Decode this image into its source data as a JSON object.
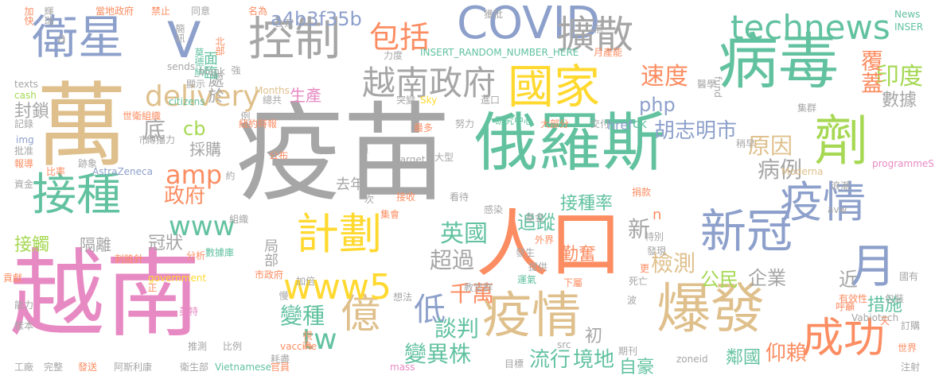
{
  "palette": {
    "gray": "#a6a6a6",
    "tan": "#dfc08c",
    "teal": "#62c2a0",
    "blue": "#8da0cb",
    "pink": "#e78ac3",
    "lime": "#a6d854",
    "yellow": "#ffd92f",
    "orange": "#fc8d62"
  },
  "words": [
    {
      "t": "疫苗",
      "c": "gray"
    },
    {
      "t": "越南",
      "c": "pink"
    },
    {
      "t": "俄羅斯",
      "c": "teal"
    },
    {
      "t": "萬",
      "c": "tan"
    },
    {
      "t": "疫情",
      "c": "tan"
    },
    {
      "t": "爆發",
      "c": "tan"
    },
    {
      "t": "病毒",
      "c": "teal"
    },
    {
      "t": "人口",
      "c": "orange"
    },
    {
      "t": "劑",
      "c": "lime"
    },
    {
      "t": "新冠",
      "c": "blue"
    },
    {
      "t": "衛星",
      "c": "blue"
    },
    {
      "t": "V",
      "c": "blue"
    },
    {
      "t": "控制",
      "c": "gray"
    },
    {
      "t": "COVID",
      "c": "blue"
    },
    {
      "t": "擴散",
      "c": "gray"
    },
    {
      "t": "國家",
      "c": "yellow"
    },
    {
      "t": "計劃",
      "c": "yellow"
    },
    {
      "t": "接種",
      "c": "teal"
    },
    {
      "t": "億",
      "c": "tan"
    },
    {
      "t": "成功",
      "c": "orange"
    },
    {
      "t": "疫情",
      "c": "blue"
    },
    {
      "t": "月",
      "c": "blue"
    },
    {
      "t": "www5",
      "c": "yellow"
    },
    {
      "t": "technews",
      "c": "teal"
    },
    {
      "t": "越南政府",
      "c": "gray"
    },
    {
      "t": "delivery",
      "c": "tan"
    },
    {
      "t": "www",
      "c": "teal"
    },
    {
      "t": "包括",
      "c": "orange"
    },
    {
      "t": "a4b3f35b",
      "c": "blue"
    },
    {
      "t": "速度",
      "c": "orange"
    },
    {
      "t": "印度",
      "c": "lime"
    },
    {
      "t": "覆蓋",
      "c": "orange"
    },
    {
      "t": "數據",
      "c": "gray"
    },
    {
      "t": "php",
      "c": "blue"
    },
    {
      "t": "胡志明市",
      "c": "blue"
    },
    {
      "t": "處於",
      "c": "gray"
    },
    {
      "t": "生產",
      "c": "pink"
    },
    {
      "t": "amp",
      "c": "orange"
    },
    {
      "t": "cb",
      "c": "lime"
    },
    {
      "t": "底",
      "c": "gray"
    },
    {
      "t": "採購",
      "c": "gray"
    },
    {
      "t": "政府",
      "c": "orange"
    },
    {
      "t": "英國",
      "c": "teal"
    },
    {
      "t": "追蹤",
      "c": "teal"
    },
    {
      "t": "超過",
      "c": "gray"
    },
    {
      "t": "局部",
      "c": "gray"
    },
    {
      "t": "接種率",
      "c": "teal"
    },
    {
      "t": "勤奮",
      "c": "orange"
    },
    {
      "t": "檢測",
      "c": "tan"
    },
    {
      "t": "公民",
      "c": "lime"
    },
    {
      "t": "企業",
      "c": "gray"
    },
    {
      "t": "近",
      "c": "gray"
    },
    {
      "t": "原因",
      "c": "tan"
    },
    {
      "t": "病例",
      "c": "gray"
    },
    {
      "t": "去年",
      "c": "gray"
    },
    {
      "t": "新",
      "c": "gray"
    },
    {
      "t": "千萬",
      "c": "orange"
    },
    {
      "t": "低",
      "c": "blue"
    },
    {
      "t": "談判",
      "c": "teal"
    },
    {
      "t": "變種",
      "c": "teal"
    },
    {
      "t": "變異株",
      "c": "teal"
    },
    {
      "t": "tw",
      "c": "teal"
    },
    {
      "t": "冠狀",
      "c": "gray"
    },
    {
      "t": "隔離",
      "c": "gray"
    },
    {
      "t": "接觸",
      "c": "lime"
    },
    {
      "t": "境地",
      "c": "teal"
    },
    {
      "t": "流行",
      "c": "teal"
    },
    {
      "t": "初",
      "c": "gray"
    },
    {
      "t": "自豪",
      "c": "teal"
    },
    {
      "t": "鄰國",
      "c": "teal"
    },
    {
      "t": "仰賴",
      "c": "orange"
    },
    {
      "t": "措施",
      "c": "teal"
    },
    {
      "t": "面臨",
      "c": "teal"
    },
    {
      "t": "封鎖",
      "c": "gray"
    },
    {
      "t": "href",
      "c": "blue"
    },
    {
      "t": "ck",
      "c": "teal"
    },
    {
      "t": "n",
      "c": "orange"
    },
    {
      "t": "a",
      "c": "gray"
    },
    {
      "t": "北部",
      "c": "orange"
    },
    {
      "t": "獲批",
      "c": "gray"
    },
    {
      "t": "前",
      "c": "gray"
    },
    {
      "t": "News",
      "c": "teal"
    },
    {
      "t": "INSER",
      "c": "teal"
    },
    {
      "t": "加快",
      "c": "orange"
    },
    {
      "t": "輝瑞",
      "c": "gray"
    },
    {
      "t": "當地政府",
      "c": "orange"
    },
    {
      "t": "禁止",
      "c": "orange"
    },
    {
      "t": "同意",
      "c": "gray"
    },
    {
      "t": "名為",
      "c": "orange"
    },
    {
      "t": "公眾",
      "c": "gray"
    },
    {
      "t": "簡訊",
      "c": "gray"
    },
    {
      "t": "莫德納",
      "c": "teal"
    },
    {
      "t": "sends",
      "c": "gray"
    },
    {
      "t": "INSERT_RANDOM_NUMBER_HERE",
      "c": "teal"
    },
    {
      "t": "力度",
      "c": "gray"
    },
    {
      "t": "月產能",
      "c": "orange"
    },
    {
      "t": "_blank",
      "c": "gray"
    },
    {
      "t": "強",
      "c": "gray"
    },
    {
      "t": "texts",
      "c": "gray"
    },
    {
      "t": "顯示",
      "c": "gray"
    },
    {
      "t": "citizens",
      "c": "teal"
    },
    {
      "t": "cash",
      "c": "lime"
    },
    {
      "t": "Months",
      "c": "tan"
    },
    {
      "t": "總共",
      "c": "gray"
    },
    {
      "t": "Sky",
      "c": "yellow"
    },
    {
      "t": "突變",
      "c": "gray"
    },
    {
      "t": "進口",
      "c": "gray"
    },
    {
      "t": "fund",
      "c": "gray"
    },
    {
      "t": "醫學",
      "c": "gray"
    },
    {
      "t": "集群",
      "c": "gray"
    },
    {
      "t": "記錄",
      "c": "gray"
    },
    {
      "t": "世衛組織",
      "c": "orange"
    },
    {
      "t": "例",
      "c": "gray"
    },
    {
      "t": "紐約時報",
      "c": "orange"
    },
    {
      "t": "最多",
      "c": "orange"
    },
    {
      "t": "努力",
      "c": "gray"
    },
    {
      "t": "研究中心",
      "c": "teal"
    },
    {
      "t": "大部分",
      "c": "orange"
    },
    {
      "t": "交付",
      "c": "gray"
    },
    {
      "t": "img",
      "c": "blue"
    },
    {
      "t": "傳播力",
      "c": "gray"
    },
    {
      "t": "市",
      "c": "gray"
    },
    {
      "t": "批准",
      "c": "gray"
    },
    {
      "t": "報導",
      "c": "orange"
    },
    {
      "t": "比率",
      "c": "orange"
    },
    {
      "t": "跡象",
      "c": "gray"
    },
    {
      "t": "AstraZeneca",
      "c": "blue"
    },
    {
      "t": "公布",
      "c": "orange"
    },
    {
      "t": "適",
      "c": "gray"
    },
    {
      "t": "target",
      "c": "gray"
    },
    {
      "t": "大型",
      "c": "gray"
    },
    {
      "t": "稍早",
      "c": "gray"
    },
    {
      "t": "Moderna",
      "c": "tan"
    },
    {
      "t": "programmeSpared",
      "c": "pink"
    },
    {
      "t": "資金",
      "c": "gray"
    },
    {
      "t": "約",
      "c": "gray"
    },
    {
      "t": "次",
      "c": "gray"
    },
    {
      "t": "接收",
      "c": "orange"
    },
    {
      "t": "看待",
      "c": "gray"
    },
    {
      "t": "浪潮",
      "c": "gray"
    },
    {
      "t": "集會",
      "c": "orange"
    },
    {
      "t": "感染",
      "c": "gray"
    },
    {
      "t": "基金",
      "c": "gray"
    },
    {
      "t": "捐款",
      "c": "orange"
    },
    {
      "t": "avw",
      "c": "gray"
    },
    {
      "t": "組織",
      "c": "gray"
    },
    {
      "t": "刺胳針",
      "c": "orange"
    },
    {
      "t": "分析",
      "c": "orange"
    },
    {
      "t": "數據庫",
      "c": "teal"
    },
    {
      "t": "外界",
      "c": "orange"
    },
    {
      "t": "特別",
      "c": "gray"
    },
    {
      "t": "發生",
      "c": "gray"
    },
    {
      "t": "提供",
      "c": "gray"
    },
    {
      "t": "發現",
      "c": "gray"
    },
    {
      "t": "government",
      "c": "yellow"
    },
    {
      "t": "市政府",
      "c": "orange"
    },
    {
      "t": "正",
      "c": "orange"
    },
    {
      "t": "教堂群",
      "c": "gray"
    },
    {
      "t": "運氣",
      "c": "teal"
    },
    {
      "t": "下屬",
      "c": "orange"
    },
    {
      "t": "死亡",
      "c": "gray"
    },
    {
      "t": "更",
      "c": "orange"
    },
    {
      "t": "貢獻",
      "c": "orange"
    },
    {
      "t": "加倍",
      "c": "gray"
    },
    {
      "t": "慢",
      "c": "gray"
    },
    {
      "t": "能力",
      "c": "gray"
    },
    {
      "t": "想法",
      "c": "gray"
    },
    {
      "t": "國有",
      "c": "gray"
    },
    {
      "t": "有效性",
      "c": "orange"
    },
    {
      "t": "呼籲",
      "c": "orange"
    },
    {
      "t": "包裝",
      "c": "gray"
    },
    {
      "t": "樣本",
      "c": "gray"
    },
    {
      "t": "波",
      "c": "gray"
    },
    {
      "t": "Vabiotech",
      "c": "gray"
    },
    {
      "t": "天",
      "c": "orange"
    },
    {
      "t": "英特",
      "c": "pink"
    },
    {
      "t": "推測",
      "c": "gray"
    },
    {
      "t": "比例",
      "c": "gray"
    },
    {
      "t": "vaccine",
      "c": "orange"
    },
    {
      "t": "視為",
      "c": "orange"
    },
    {
      "t": "src",
      "c": "gray"
    },
    {
      "t": "期刊",
      "c": "gray"
    },
    {
      "t": "訂購",
      "c": "gray"
    },
    {
      "t": "zoneid",
      "c": "gray"
    },
    {
      "t": "世界",
      "c": "orange"
    },
    {
      "t": "工廠",
      "c": "gray"
    },
    {
      "t": "完整",
      "c": "gray"
    },
    {
      "t": "發送",
      "c": "orange"
    },
    {
      "t": "阿斯利康",
      "c": "gray"
    },
    {
      "t": "衛生部",
      "c": "gray"
    },
    {
      "t": "Vietnamese",
      "c": "teal"
    },
    {
      "t": "耗盡",
      "c": "gray"
    },
    {
      "t": "官員",
      "c": "orange"
    },
    {
      "t": "mass",
      "c": "pink"
    },
    {
      "t": "目標",
      "c": "gray"
    },
    {
      "t": "注射",
      "c": "gray"
    }
  ]
}
